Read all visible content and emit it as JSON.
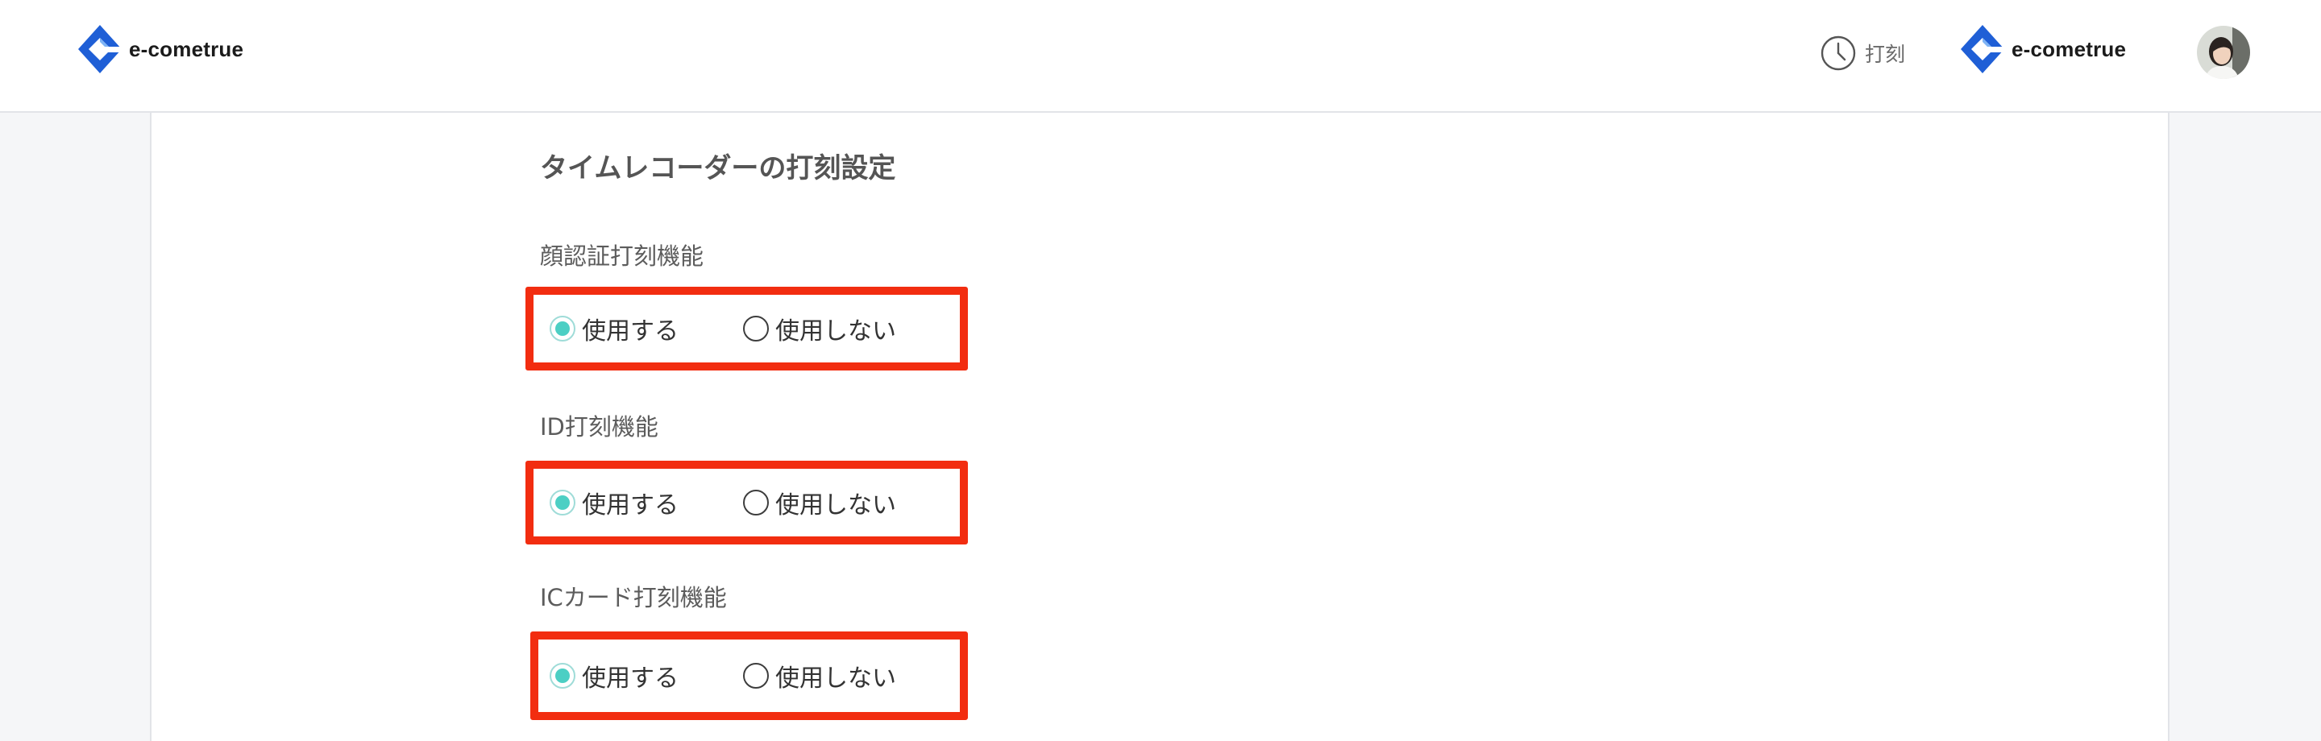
{
  "header": {
    "logo_left_text": "e-cometrue",
    "clock_label": "打刻",
    "logo_right_text": "e-cometrue",
    "brand_color": "#1f5fd6",
    "icons": [
      "e-cometrue-logo-icon",
      "clock-icon",
      "user-avatar"
    ]
  },
  "main": {
    "section_title": "タイムレコーダーの打刻設定",
    "groups": [
      {
        "label": "顔認証打刻機能",
        "options": [
          {
            "label": "使用する",
            "selected": true
          },
          {
            "label": "使用しない",
            "selected": false
          }
        ]
      },
      {
        "label": "ID打刻機能",
        "options": [
          {
            "label": "使用する",
            "selected": true
          },
          {
            "label": "使用しない",
            "selected": false
          }
        ]
      },
      {
        "label": "ICカード打刻機能",
        "options": [
          {
            "label": "使用する",
            "selected": true
          },
          {
            "label": "使用しない",
            "selected": false
          }
        ]
      }
    ]
  },
  "colors": {
    "highlight_box": "#f22d10",
    "radio_selected": "#4ccfc4",
    "page_background": "#f5f6f8"
  }
}
